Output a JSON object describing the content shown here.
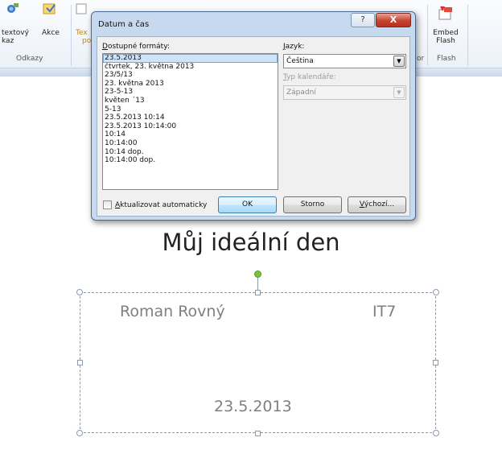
{
  "ribbon": {
    "textovy_odkaz": [
      "textový",
      "kaz"
    ],
    "akce": "Akce",
    "group_odkazy": "Odkazy",
    "text_partial": [
      "Tex",
      "po"
    ],
    "group_right_partial": "or",
    "embed_flash": [
      "Embed",
      "Flash"
    ],
    "group_flash": "Flash"
  },
  "dialog": {
    "title": "Datum a čas",
    "help_button": "?",
    "close_button": "X",
    "formats_label_hotkey": "D",
    "formats_label_rest": "ostupné formáty:",
    "formats": [
      "23.5.2013",
      "čtvrtek, 23. května 2013",
      "23/5/13",
      "23. května 2013",
      "23-5-13",
      "květen ´13",
      "5-13",
      "23.5.2013 10:14",
      "23.5.2013 10:14:00",
      "10:14",
      "10:14:00",
      "10:14 dop.",
      "10:14:00 dop."
    ],
    "selected_format_index": 0,
    "language_label_hotkey": "J",
    "language_label_rest": "azyk:",
    "language_value": "Čeština",
    "calendar_label_hotkey": "T",
    "calendar_label_rest": "yp kalendáře:",
    "calendar_value": "Západní",
    "auto_update_hotkey": "A",
    "auto_update_rest": "ktualizovat automaticky",
    "auto_update_checked": false,
    "ok_button": "OK",
    "cancel_button": "Storno",
    "default_button_hotkey": "V",
    "default_button_rest": "ýchozí..."
  },
  "slide": {
    "title": "Můj ideální den",
    "author": "Roman Rovný",
    "class": "IT7",
    "date": "23.5.2013"
  }
}
